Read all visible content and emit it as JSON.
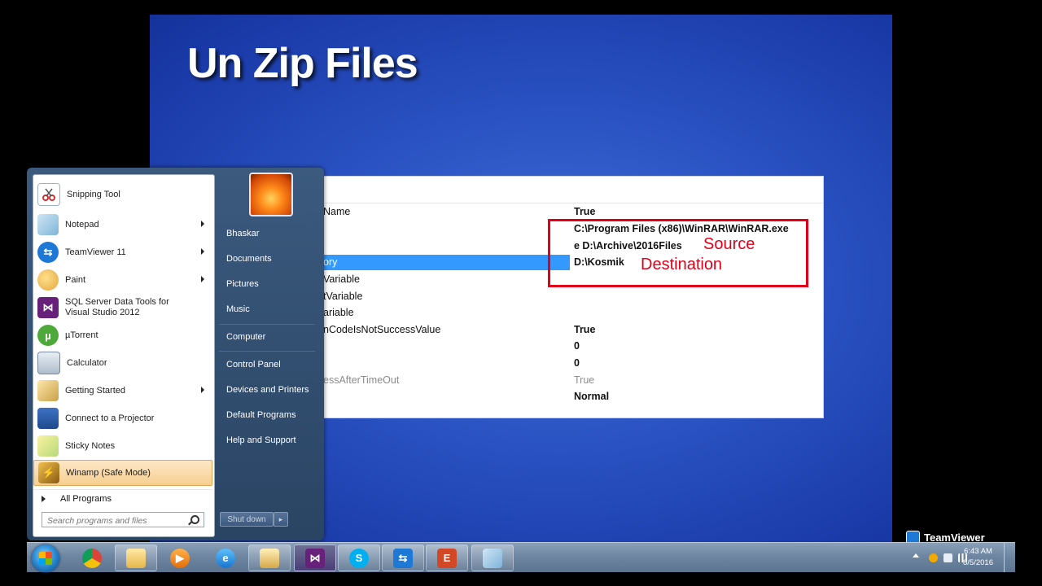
{
  "slide": {
    "title": "Un Zip Files"
  },
  "properties": {
    "rows": [
      {
        "name": "Name",
        "value": "True",
        "name_gray": false,
        "value_gray": false
      },
      {
        "name": "",
        "value": "C:\\Program Files (x86)\\WinRAR\\WinRAR.exe",
        "name_gray": false,
        "value_gray": false
      },
      {
        "name": "",
        "value": "e D:\\Archive\\2016Files",
        "name_gray": false,
        "value_gray": false
      },
      {
        "name": "ory",
        "value": "D:\\Kosmik",
        "name_gray": false,
        "value_gray": false
      },
      {
        "name": "Variable",
        "value": "",
        "name_gray": false,
        "value_gray": false
      },
      {
        "name": "tVariable",
        "value": "",
        "name_gray": false,
        "value_gray": false
      },
      {
        "name": "ariable",
        "value": "",
        "name_gray": false,
        "value_gray": false
      },
      {
        "name": "nCodeIsNotSuccessValue",
        "value": "True",
        "name_gray": false,
        "value_gray": false
      },
      {
        "name": "",
        "value": "0",
        "name_gray": false,
        "value_gray": false
      },
      {
        "name": "",
        "value": "0",
        "name_gray": false,
        "value_gray": false
      },
      {
        "name": "essAfterTimeOut",
        "value": "True",
        "name_gray": true,
        "value_gray": true
      },
      {
        "name": "",
        "value": "Normal",
        "name_gray": false,
        "value_gray": false
      }
    ],
    "annotations": {
      "source": "Source",
      "destination": "Destination"
    },
    "highlight_color": "#e0001a"
  },
  "start_menu": {
    "programs": [
      {
        "label": "Snipping Tool",
        "icon": "scissors-icon",
        "arrow": false
      },
      {
        "label": "Notepad",
        "icon": "notepad-icon",
        "arrow": true
      },
      {
        "label": "TeamViewer 11",
        "icon": "teamviewer-icon",
        "arrow": true
      },
      {
        "label": "Paint",
        "icon": "paint-icon",
        "arrow": true
      },
      {
        "label": "SQL Server Data Tools for Visual Studio 2012",
        "icon": "visual-studio-icon",
        "arrow": false
      },
      {
        "label": "µTorrent",
        "icon": "utorrent-icon",
        "arrow": false
      },
      {
        "label": "Calculator",
        "icon": "calculator-icon",
        "arrow": false
      },
      {
        "label": "Getting Started",
        "icon": "getting-started-icon",
        "arrow": true
      },
      {
        "label": "Connect to a Projector",
        "icon": "projector-icon",
        "arrow": false
      },
      {
        "label": "Sticky Notes",
        "icon": "sticky-notes-icon",
        "arrow": false
      },
      {
        "label": "Winamp (Safe Mode)",
        "icon": "winamp-icon",
        "arrow": false
      }
    ],
    "all_programs": "All Programs",
    "search_placeholder": "Search programs and files",
    "right_links": [
      "Bhaskar",
      "Documents",
      "Pictures",
      "Music",
      "Computer",
      "Control Panel",
      "Devices and Printers",
      "Default Programs",
      "Help and Support"
    ],
    "shutdown_label": "Shut down"
  },
  "taskbar": {
    "apps": [
      {
        "name": "chrome-icon"
      },
      {
        "name": "file-explorer-icon"
      },
      {
        "name": "media-player-icon"
      },
      {
        "name": "internet-explorer-icon"
      },
      {
        "name": "network-tool-icon"
      },
      {
        "name": "visual-studio-icon"
      },
      {
        "name": "skype-icon"
      },
      {
        "name": "teamviewer-icon"
      },
      {
        "name": "office-icon"
      },
      {
        "name": "notepad-icon"
      }
    ],
    "clock_time": "6:43 AM",
    "clock_date": "8/5/2016",
    "watermark": "TeamViewer"
  }
}
